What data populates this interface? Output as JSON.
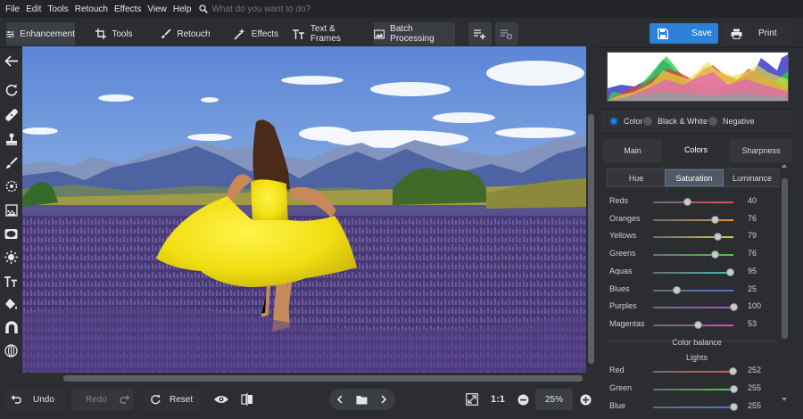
{
  "menubar": {
    "items": [
      "File",
      "Edit",
      "Tools",
      "Retouch",
      "Effects",
      "View",
      "Help"
    ],
    "search_placeholder": "What do you want to do?"
  },
  "toolbar": {
    "tabs": [
      {
        "label": "Enhancement",
        "icon": "sliders-icon",
        "active": true
      },
      {
        "label": "Tools",
        "icon": "crop-icon"
      },
      {
        "label": "Retouch",
        "icon": "brush-icon"
      },
      {
        "label": "Effects",
        "icon": "magic-wand-icon"
      },
      {
        "label": "Text & Frames",
        "icon": "text-icon"
      }
    ],
    "batch_label": "Batch Processing",
    "save_label": "Save",
    "print_label": "Print"
  },
  "left_tools": [
    "back-arrow-icon",
    "rotate-icon",
    "healing-patch-icon",
    "clone-stamp-icon",
    "brush-icon",
    "radial-icon",
    "gradient-icon",
    "vignette-icon",
    "light-icon",
    "text-icon",
    "bucket-icon",
    "magnet-icon",
    "globe-icon"
  ],
  "bottom": {
    "undo_label": "Undo",
    "redo_label": "Redo",
    "reset_label": "Reset",
    "ratio_label": "1:1",
    "zoom_value": "25%"
  },
  "right_panel": {
    "mode_options": [
      {
        "label": "Color",
        "selected": true
      },
      {
        "label": "Black & White",
        "selected": false
      },
      {
        "label": "Negative",
        "selected": false
      }
    ],
    "main_tabs": [
      {
        "label": "Main",
        "active": false
      },
      {
        "label": "Colors",
        "active": true
      },
      {
        "label": "Sharpness",
        "active": false
      }
    ],
    "sub_tabs": [
      {
        "label": "Hue",
        "active": false
      },
      {
        "label": "Saturation",
        "active": true
      },
      {
        "label": "Luminance",
        "active": false
      }
    ],
    "sliders": [
      {
        "label": "Reds",
        "value": "40",
        "pos": 0.4,
        "color": "#e05252"
      },
      {
        "label": "Oranges",
        "value": "76",
        "pos": 0.76,
        "color": "#e8913c"
      },
      {
        "label": "Yellows",
        "value": "79",
        "pos": 0.79,
        "color": "#d9cf3c"
      },
      {
        "label": "Greens",
        "value": "76",
        "pos": 0.76,
        "color": "#58c24e"
      },
      {
        "label": "Aquas",
        "value": "95",
        "pos": 0.95,
        "color": "#3fbfb4"
      },
      {
        "label": "Blues",
        "value": "25",
        "pos": 0.25,
        "color": "#4a6de0"
      },
      {
        "label": "Purples",
        "value": "100",
        "pos": 1.0,
        "color": "#9a55d8"
      },
      {
        "label": "Magentas",
        "value": "53",
        "pos": 0.53,
        "color": "#d04fb4"
      }
    ],
    "color_balance_label": "Color balance",
    "lights_label": "Lights",
    "balance_sliders": [
      {
        "label": "Red",
        "value": "252",
        "pos": 0.99,
        "color": "#e05252"
      },
      {
        "label": "Green",
        "value": "255",
        "pos": 1.0,
        "color": "#58c24e"
      },
      {
        "label": "Blue",
        "value": "255",
        "pos": 1.0,
        "color": "#4a6de0"
      }
    ]
  },
  "colors": {
    "accent": "#2b80d9",
    "panel": "#2b2d31",
    "menubar": "#232427"
  }
}
